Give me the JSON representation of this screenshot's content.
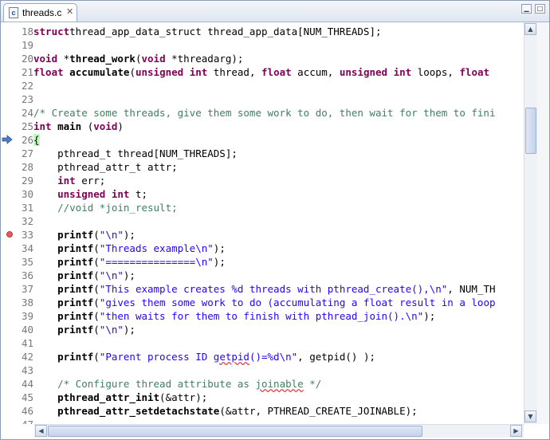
{
  "tab": {
    "title": "threads.c",
    "close": "✕",
    "file_icon": "c"
  },
  "window": {
    "minimize": "▁",
    "maximize": "□"
  },
  "lines": [
    {
      "n": "18",
      "seg": [
        [
          "kw",
          "struct"
        ],
        [
          "",
          "thread_app_data_struct thread_app_data[NUM_THREADS];"
        ]
      ]
    },
    {
      "n": "19",
      "seg": []
    },
    {
      "n": "20",
      "seg": [
        [
          "kw",
          "void"
        ],
        [
          "",
          " *"
        ],
        [
          "fn",
          "thread_work"
        ],
        [
          "",
          "("
        ],
        [
          "kw",
          "void"
        ],
        [
          "",
          " *threadarg);"
        ]
      ]
    },
    {
      "n": "21",
      "seg": [
        [
          "kw",
          "float"
        ],
        [
          "",
          " "
        ],
        [
          "fn",
          "accumulate"
        ],
        [
          "",
          "("
        ],
        [
          "kw",
          "unsigned int"
        ],
        [
          "",
          " thread, "
        ],
        [
          "kw",
          "float"
        ],
        [
          "",
          " accum, "
        ],
        [
          "kw",
          "unsigned int"
        ],
        [
          "",
          " loops, "
        ],
        [
          "kw",
          "float"
        ]
      ]
    },
    {
      "n": "22",
      "seg": []
    },
    {
      "n": "23",
      "seg": []
    },
    {
      "n": "24",
      "seg": [
        [
          "cm",
          "/* Create some threads, give them some work to do, then wait for them to fini"
        ]
      ]
    },
    {
      "n": "25",
      "seg": [
        [
          "kw",
          "int"
        ],
        [
          "",
          " "
        ],
        [
          "fn",
          "main"
        ],
        [
          "",
          " ("
        ],
        [
          "kw",
          "void"
        ],
        [
          "",
          ")"
        ]
      ]
    },
    {
      "n": "26",
      "seg": [
        [
          "hl",
          "{"
        ]
      ]
    },
    {
      "n": "27",
      "seg": [
        [
          "",
          "    pthread_t thread[NUM_THREADS];"
        ]
      ]
    },
    {
      "n": "28",
      "seg": [
        [
          "",
          "    pthread_attr_t attr;"
        ]
      ]
    },
    {
      "n": "29",
      "seg": [
        [
          "",
          "    "
        ],
        [
          "kw",
          "int"
        ],
        [
          "",
          " err;"
        ]
      ]
    },
    {
      "n": "30",
      "seg": [
        [
          "",
          "    "
        ],
        [
          "kw",
          "unsigned int"
        ],
        [
          "",
          " t;"
        ]
      ]
    },
    {
      "n": "31",
      "seg": [
        [
          "",
          "    "
        ],
        [
          "cm",
          "//void *join_result;"
        ]
      ]
    },
    {
      "n": "32",
      "seg": []
    },
    {
      "n": "33",
      "seg": [
        [
          "",
          "    "
        ],
        [
          "fn",
          "printf"
        ],
        [
          "",
          "("
        ],
        [
          "str",
          "\"\\n\""
        ],
        [
          "",
          ");"
        ]
      ]
    },
    {
      "n": "34",
      "seg": [
        [
          "",
          "    "
        ],
        [
          "fn",
          "printf"
        ],
        [
          "",
          "("
        ],
        [
          "str",
          "\"Threads example\\n\""
        ],
        [
          "",
          ");"
        ]
      ]
    },
    {
      "n": "35",
      "seg": [
        [
          "",
          "    "
        ],
        [
          "fn",
          "printf"
        ],
        [
          "",
          "("
        ],
        [
          "str",
          "\"===============\\n\""
        ],
        [
          "",
          ");"
        ]
      ]
    },
    {
      "n": "36",
      "seg": [
        [
          "",
          "    "
        ],
        [
          "fn",
          "printf"
        ],
        [
          "",
          "("
        ],
        [
          "str",
          "\"\\n\""
        ],
        [
          "",
          ");"
        ]
      ]
    },
    {
      "n": "37",
      "seg": [
        [
          "",
          "    "
        ],
        [
          "fn",
          "printf"
        ],
        [
          "",
          "("
        ],
        [
          "str",
          "\"This example creates %d threads with pthread_create(),\\n\""
        ],
        [
          "",
          ", NUM_TH"
        ]
      ]
    },
    {
      "n": "38",
      "seg": [
        [
          "",
          "    "
        ],
        [
          "fn",
          "printf"
        ],
        [
          "",
          "("
        ],
        [
          "str",
          "\"gives them some work to do (accumulating a float result in a loop"
        ]
      ]
    },
    {
      "n": "39",
      "seg": [
        [
          "",
          "    "
        ],
        [
          "fn",
          "printf"
        ],
        [
          "",
          "("
        ],
        [
          "str",
          "\"then waits for them to finish with pthread_join().\\n\""
        ],
        [
          "",
          ");"
        ]
      ]
    },
    {
      "n": "40",
      "seg": [
        [
          "",
          "    "
        ],
        [
          "fn",
          "printf"
        ],
        [
          "",
          "("
        ],
        [
          "str",
          "\"\\n\""
        ],
        [
          "",
          ");"
        ]
      ]
    },
    {
      "n": "41",
      "seg": []
    },
    {
      "n": "42",
      "seg": [
        [
          "",
          "    "
        ],
        [
          "fn",
          "printf"
        ],
        [
          "",
          "("
        ],
        [
          "str",
          "\"Parent process ID "
        ],
        [
          "str sq",
          "getpid"
        ],
        [
          "str",
          "()=%d\\n\""
        ],
        [
          "",
          ", getpid() );"
        ]
      ]
    },
    {
      "n": "43",
      "seg": []
    },
    {
      "n": "44",
      "seg": [
        [
          "",
          "    "
        ],
        [
          "cm",
          "/* Configure thread attribute as "
        ],
        [
          "cm sq",
          "joinable"
        ],
        [
          "cm",
          " */"
        ]
      ]
    },
    {
      "n": "45",
      "seg": [
        [
          "",
          "    "
        ],
        [
          "fn",
          "pthread_attr_init"
        ],
        [
          "",
          "(&attr);"
        ]
      ]
    },
    {
      "n": "46",
      "seg": [
        [
          "",
          "    "
        ],
        [
          "fn",
          "pthread_attr_setdetachstate"
        ],
        [
          "",
          "(&attr, PTHREAD_CREATE_JOINABLE);"
        ]
      ]
    },
    {
      "n": "47",
      "seg": []
    }
  ],
  "markers": {
    "current_line": "26",
    "breakpoint_line": "33"
  },
  "scroll": {
    "vertical_position": 0.22,
    "horizontal_position": 0.0
  },
  "arrows": {
    "up": "▲",
    "down": "▼",
    "left": "◀",
    "right": "▶"
  }
}
